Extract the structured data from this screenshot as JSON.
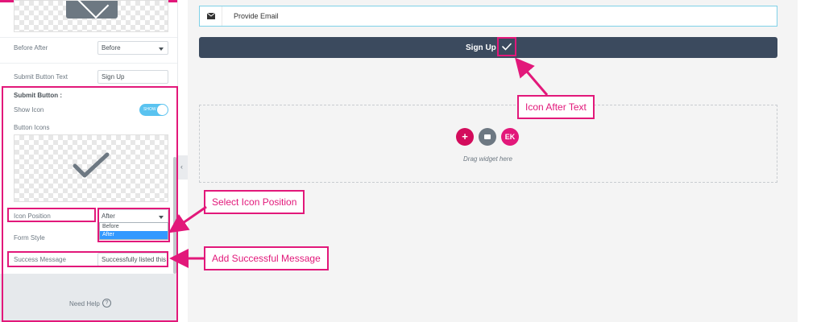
{
  "panel": {
    "before_after": {
      "label": "Before After",
      "value": "Before"
    },
    "submit_button_text": {
      "label": "Submit Button Text",
      "value": "Sign Up"
    },
    "submit_button_section": "Submit Button :",
    "show_icon": {
      "label": "Show Icon",
      "toggle_text": "SHOW",
      "enabled": true
    },
    "button_icons_label": "Button Icons",
    "icon_position": {
      "label": "Icon Position",
      "value": "After",
      "options": [
        "Before",
        "After"
      ],
      "selected": "After"
    },
    "form_style_label": "Form Style",
    "success_message": {
      "label": "Success Message",
      "value": "Successfully listed this"
    },
    "need_help": "Need Help",
    "help_glyph": "?",
    "collapse_glyph": "‹"
  },
  "preview": {
    "email_placeholder": "Provide Email",
    "signup_label": "Sign Up",
    "add_glyph": "+",
    "ek_glyph": "EK",
    "drag_text": "Drag widget here"
  },
  "callouts": {
    "icon_after_text": "Icon After Text",
    "select_icon_position": "Select Icon Position",
    "add_successful_message": "Add Successful Message"
  },
  "colors": {
    "highlight": "#e2187a",
    "button_bg": "#3b4a5e",
    "toggle_on": "#5ac3f0",
    "dropdown_selected": "#3399ff"
  }
}
